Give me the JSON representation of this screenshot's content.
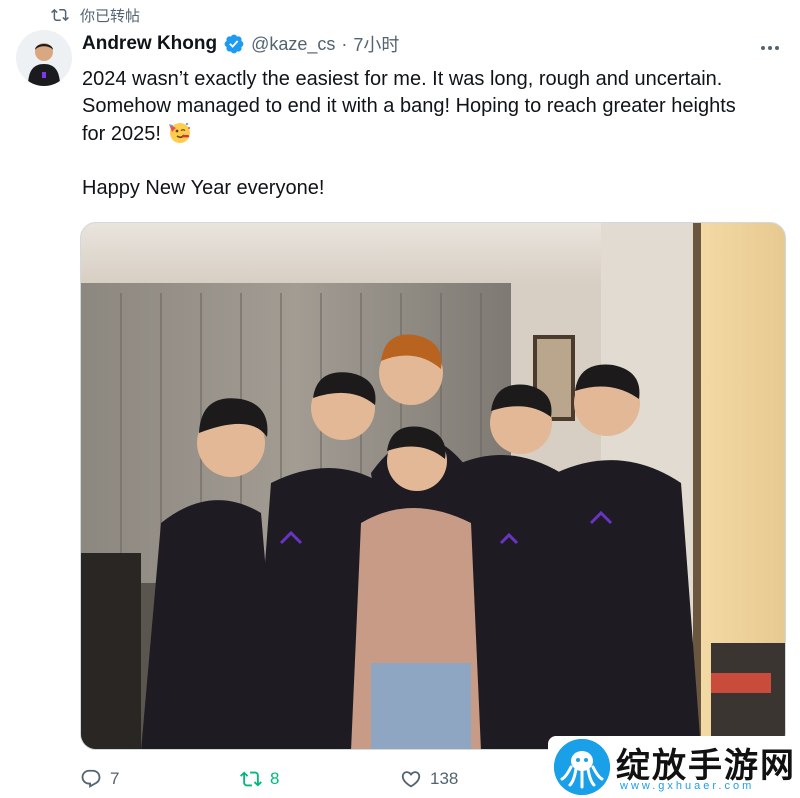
{
  "retweet": {
    "label": "你已转帖",
    "icon": "retweet-icon"
  },
  "author": {
    "name": "Andrew Khong",
    "handle": "@kaze_cs",
    "separator": "·",
    "time": "7小时",
    "verified": true
  },
  "tweet": {
    "line1": "2024 wasn’t exactly the easiest for me. It was long, rough and uncertain.",
    "line2": "Somehow managed to end it with a bang! Hoping to reach greater heights",
    "line3": "for 2025!",
    "line4": "Happy New Year everyone!",
    "emoji": "partying-face"
  },
  "actions": {
    "replies": "7",
    "retweets": "8",
    "likes": "138"
  },
  "watermark": {
    "title": "绽放手游网",
    "url": "www.gxhuaer.com"
  },
  "colors": {
    "text": "#0f1419",
    "secondary": "#536471",
    "verified": "#1d9bf0",
    "retweeted": "#00ba7c",
    "watermark_blue": "#1aa0e8"
  }
}
